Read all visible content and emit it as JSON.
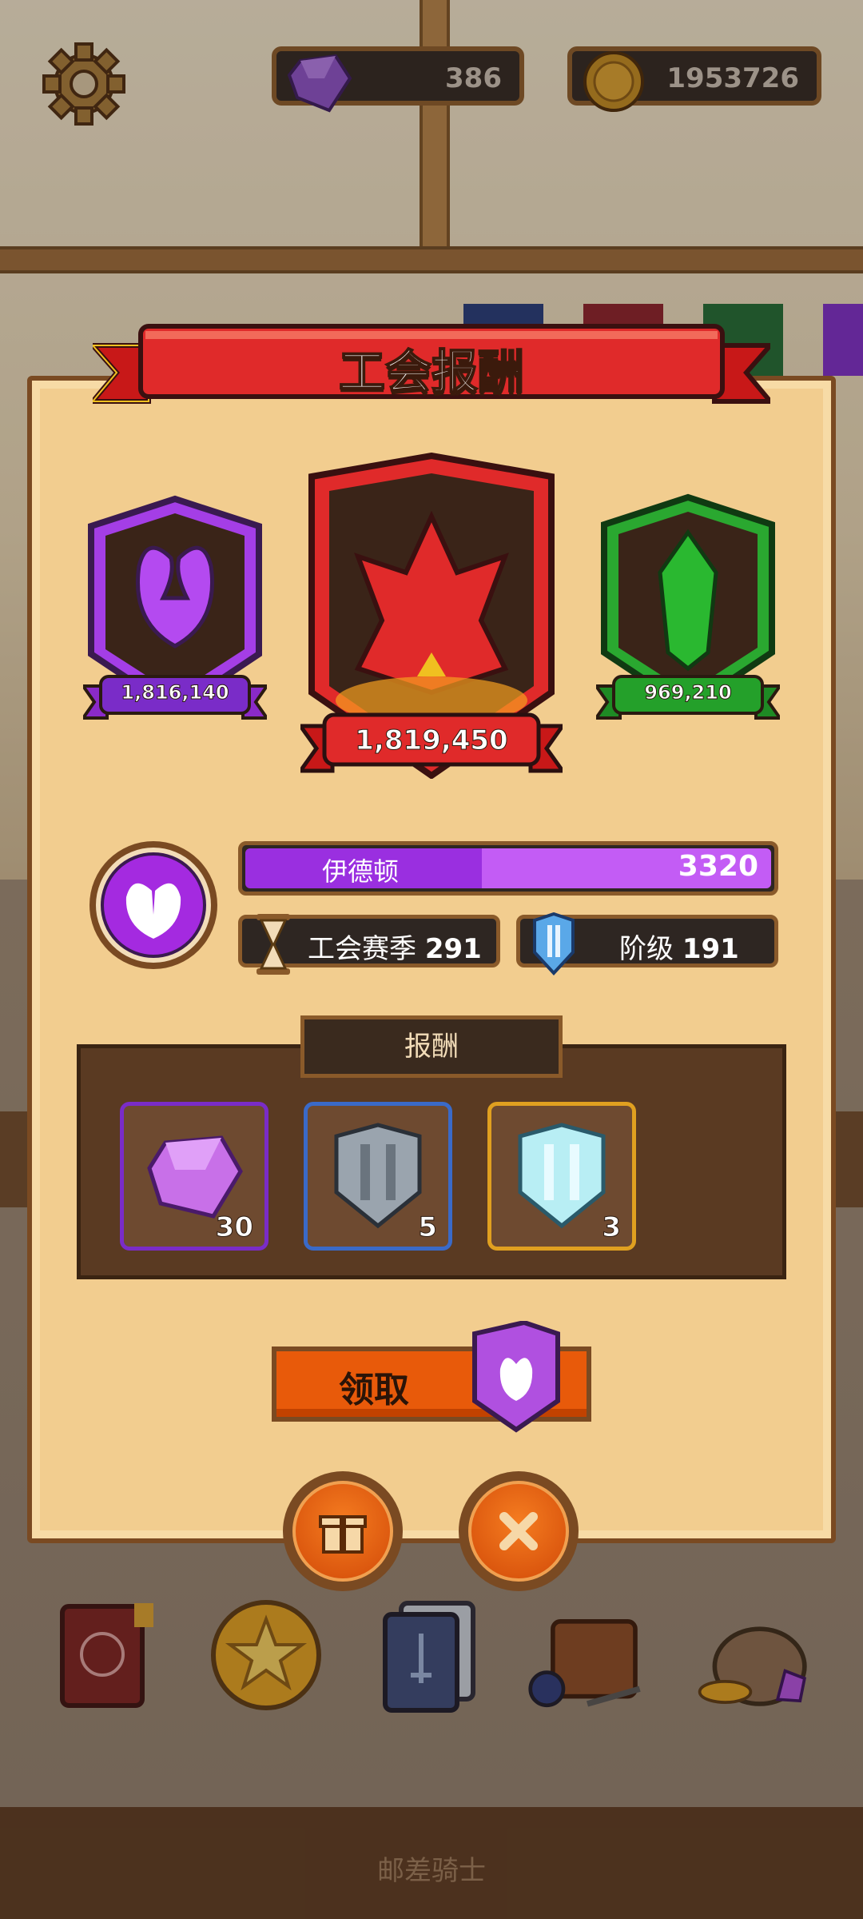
{
  "currency": {
    "gems": "386",
    "coins": "1953726"
  },
  "panel": {
    "title": "工会报酬"
  },
  "crests": {
    "left_score": "1,816,140",
    "center_score": "1,819,450",
    "right_score": "969,210"
  },
  "guild": {
    "name": "伊德顿",
    "points": "3320",
    "progress_fraction": 0.45,
    "season_label": "工会赛季",
    "season_value": "291",
    "rank_label": "阶级",
    "rank_value": "191"
  },
  "rewards": {
    "label": "报酬",
    "items": [
      {
        "icon": "purple-gem-icon",
        "count": "30",
        "border": "#7a2cc8"
      },
      {
        "icon": "iron-shield-icon",
        "count": "5",
        "border": "#3a6ac8"
      },
      {
        "icon": "ice-shield-icon",
        "count": "3",
        "border": "#e0a020"
      }
    ]
  },
  "buttons": {
    "claim_label": "领取"
  },
  "footer": {
    "text": "邮差骑士"
  },
  "colors": {
    "purple_team": "#a43ee6",
    "red_team": "#e02a2a",
    "green_team": "#2aa830",
    "panel_bg": "#f2cd8f",
    "frame": "#7a4a22"
  }
}
